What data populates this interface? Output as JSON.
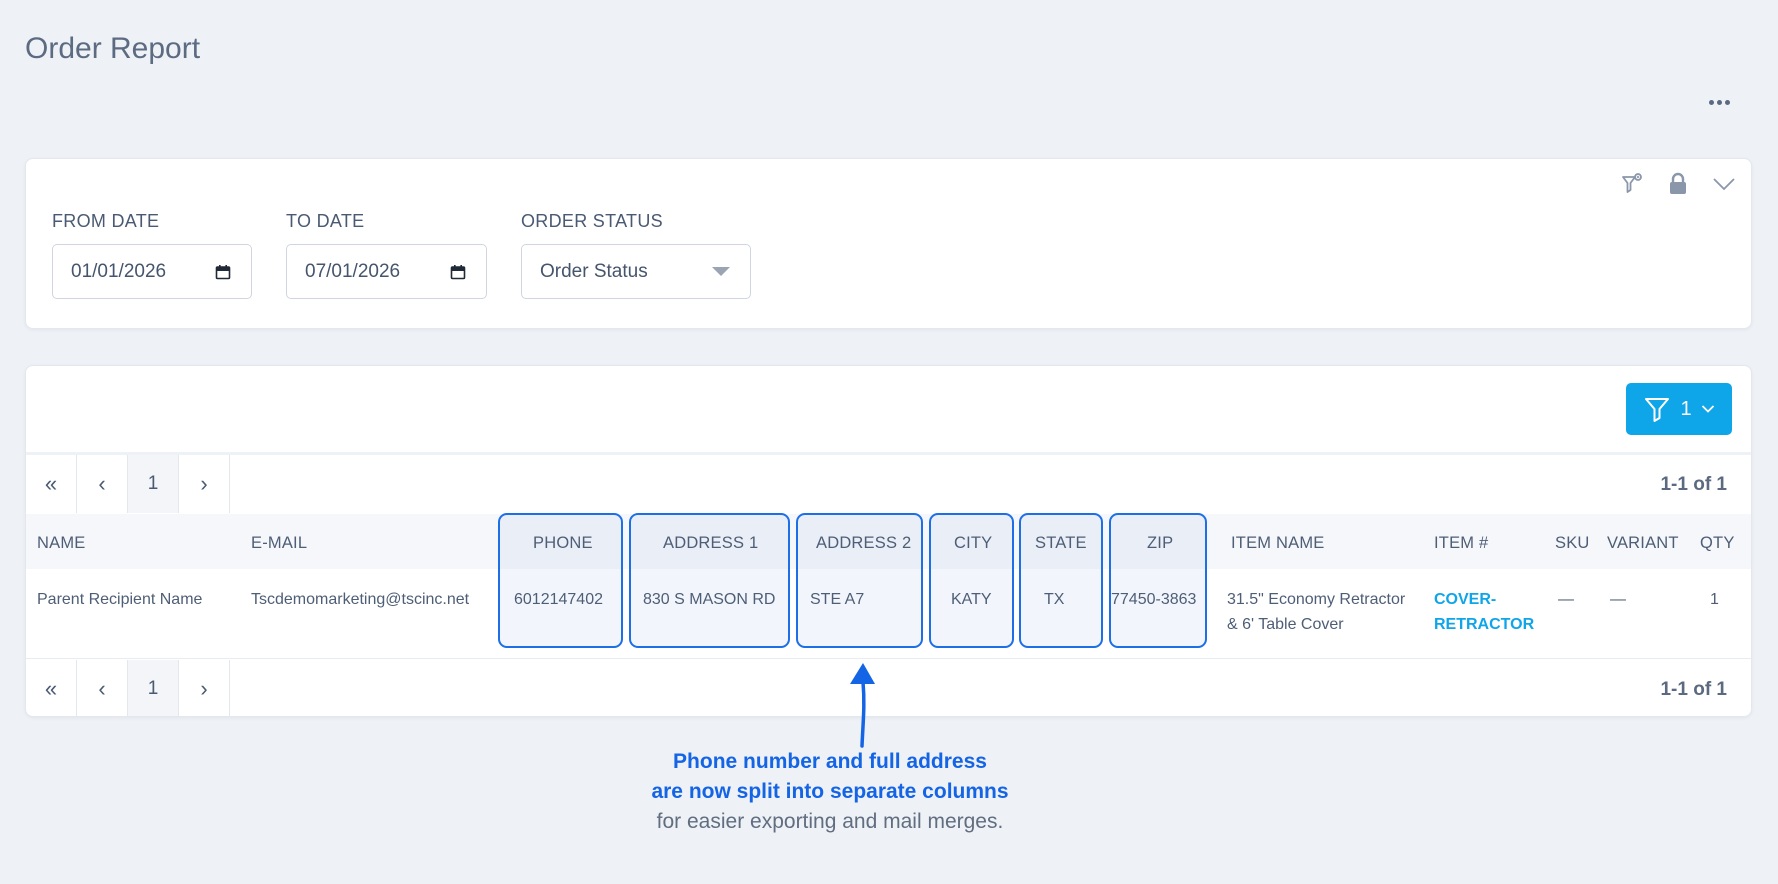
{
  "page": {
    "title": "Order Report"
  },
  "filters": {
    "from_date": {
      "label": "FROM DATE",
      "value": "01/01/2026"
    },
    "to_date": {
      "label": "TO DATE",
      "value": "07/01/2026"
    },
    "order_status": {
      "label": "ORDER STATUS",
      "value": "Order Status"
    }
  },
  "results": {
    "filter_count": "1",
    "pager": {
      "first": "«",
      "prev": "‹",
      "page": "1",
      "next": "›"
    },
    "range": "1-1 of 1",
    "columns": [
      "NAME",
      "E-MAIL",
      "PHONE",
      "ADDRESS 1",
      "ADDRESS 2",
      "CITY",
      "STATE",
      "ZIP",
      "ITEM NAME",
      "ITEM #",
      "SKU",
      "VARIANT",
      "QTY"
    ],
    "rows": [
      [
        "Parent Recipient Name",
        "Tscdemomarketing@tscinc.net",
        "6012147402",
        "830 S MASON RD",
        "STE A7",
        "KATY",
        "TX",
        "77450-3863",
        "31.5\" Economy Retractor & 6' Table Cover",
        "COVER-RETRACTOR",
        "—",
        "—",
        "1"
      ]
    ]
  },
  "annotation": {
    "line1": "Phone number and full address",
    "line2": "are now split into separate columns",
    "line3": "for easier exporting and mail merges."
  },
  "colors": {
    "accent": "#0ea5e9",
    "highlight": "#1d6fe8",
    "annotation": "#1464e6"
  }
}
